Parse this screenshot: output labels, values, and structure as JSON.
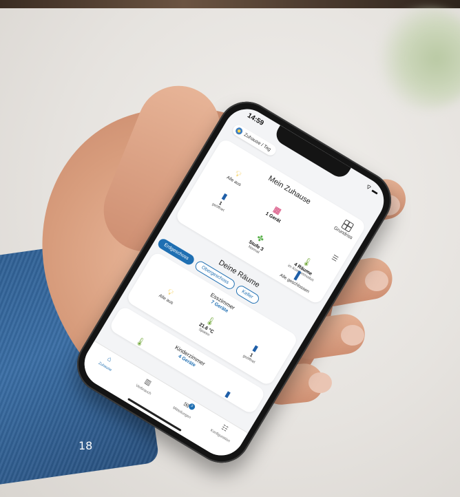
{
  "status_bar": {
    "time": "14:59",
    "icons": "⌔ ▬"
  },
  "home_selector": {
    "label": "Zuhause / Tag"
  },
  "home_card": {
    "title": "Mein Zuhause",
    "floorplan_label": "Grundriss",
    "items": {
      "lights": {
        "value": "Alle aus"
      },
      "windows": {
        "value": "1",
        "sub": "geöffnet"
      },
      "calendar": {
        "value": "1 Gerät"
      },
      "ventilation": {
        "value": "Stufe 3",
        "sub": "Normal"
      },
      "climate": {
        "value": "4 Räume",
        "sub": "im Komfortmodus"
      },
      "doors": {
        "value": "Alle geschlossen"
      }
    }
  },
  "rooms": {
    "title": "Deine Räume",
    "floors": [
      "Erdgeschoss",
      "Obergeschoss",
      "Keller"
    ],
    "room1": {
      "name": "Esszimmer",
      "devices": "7 Geräte",
      "lights": "Alle aus",
      "temp": "21.6 °C",
      "temp_mode": "Sparen",
      "windows": "1",
      "windows_sub": "geöffnet"
    },
    "room2": {
      "name": "Kinderzimmer",
      "devices": "4 Geräte"
    }
  },
  "tabbar": {
    "items": [
      "Zuhause",
      "Verbrauch",
      "Mitteilungen",
      "Konfiguration"
    ],
    "badge": "3"
  },
  "page_number": "18"
}
